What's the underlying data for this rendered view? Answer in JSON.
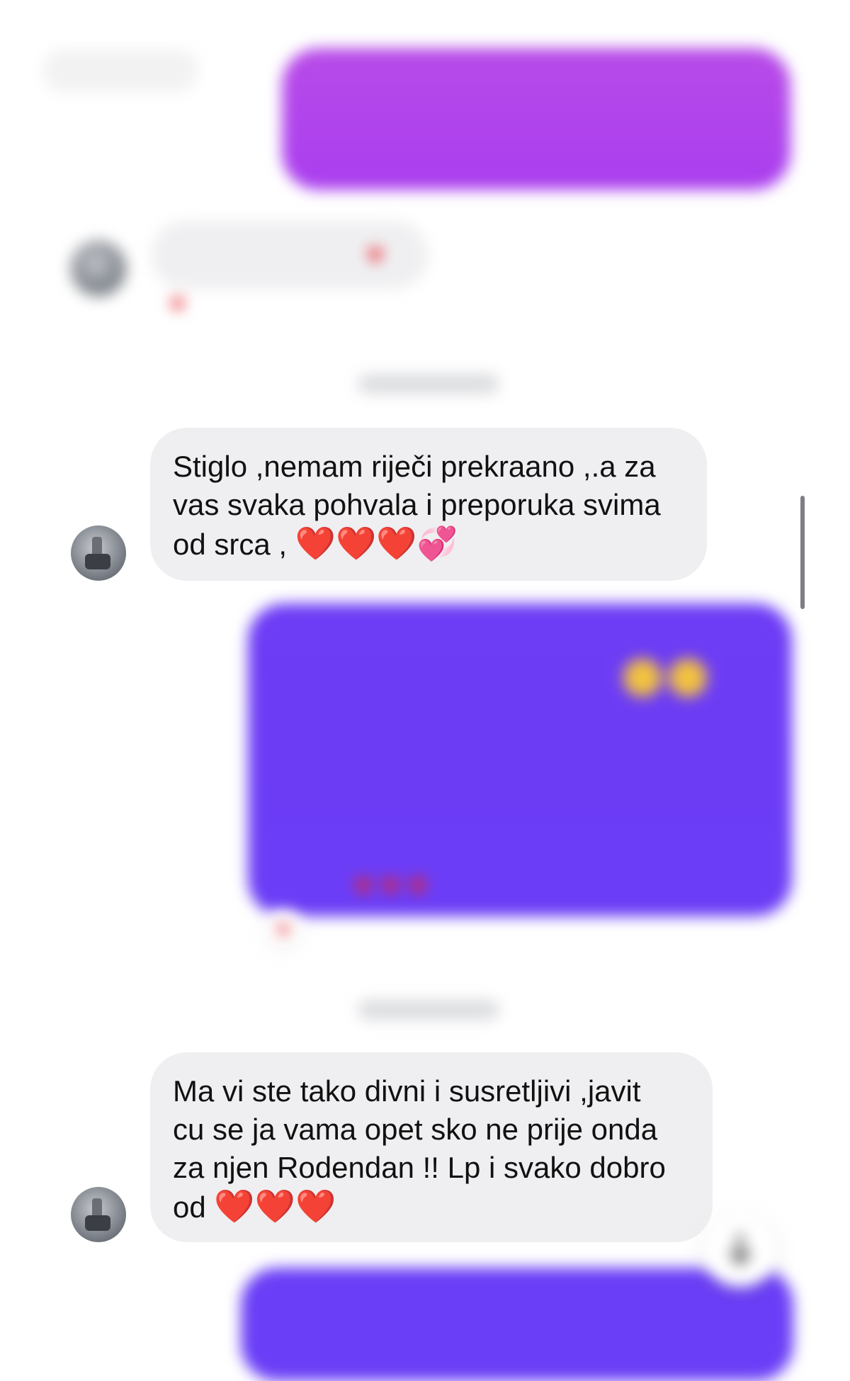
{
  "messages": {
    "incoming_1_text": "Stiglo ,nemam riječi prekraano ,.a za vas svaka pohvala i preporuka svima od srca ,",
    "incoming_1_line1": "Stiglo ,nemam riječi prekraano ,.a za",
    "incoming_1_line2": "vas svaka pohvala i preporuka svima",
    "incoming_1_line3": "od srca ,",
    "incoming_1_emoji": "❤️❤️❤️💞",
    "incoming_2_line1": "Ma vi ste tako divni i susretljivi ,javit",
    "incoming_2_line2": "cu se ja vama opet sko ne prije onda",
    "incoming_2_line3": "za njen Rodendan !! Lp i svako dobro",
    "incoming_2_line4": "od",
    "incoming_2_emoji": "❤️❤️❤️"
  },
  "colors": {
    "outgoing_top": "#b440ec",
    "outgoing_mid": "#7a3cf4",
    "outgoing_bottom": "#6a3ef6",
    "incoming_bubble": "#efeff1"
  },
  "icons": {
    "reaction": "heart-icon",
    "scroll_down": "arrow-down-icon"
  }
}
